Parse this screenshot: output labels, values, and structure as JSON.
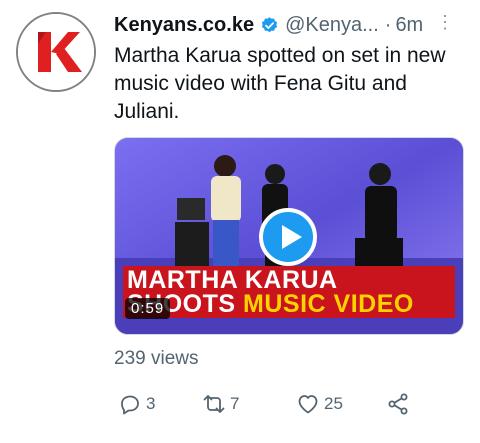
{
  "tweet": {
    "display_name": "Kenyans.co.ke",
    "handle": "@Kenya...",
    "separator": "·",
    "time": "6m",
    "more_label": "⋮",
    "text": "Martha Karua spotted on set in new music video with Fena Gitu and Juliani.",
    "views": "239 views"
  },
  "media": {
    "banner_line1": "MARTHA KARUA",
    "banner_line2_a": "SHOOTS ",
    "banner_line2_b": "MUSIC VIDEO",
    "duration": "0:59"
  },
  "actions": {
    "reply_count": "3",
    "retweet_count": "7",
    "like_count": "25"
  },
  "icons": {
    "avatar": "kenyans-logo-icon",
    "verified": "verified-badge-icon",
    "reply": "reply-icon",
    "retweet": "retweet-icon",
    "like": "heart-icon",
    "share": "share-icon",
    "play": "play-icon"
  },
  "colors": {
    "brand_red": "#e02020",
    "verified_blue": "#1d9bf0",
    "banner_red": "#c9141d",
    "banner_yellow": "#ffd200"
  }
}
